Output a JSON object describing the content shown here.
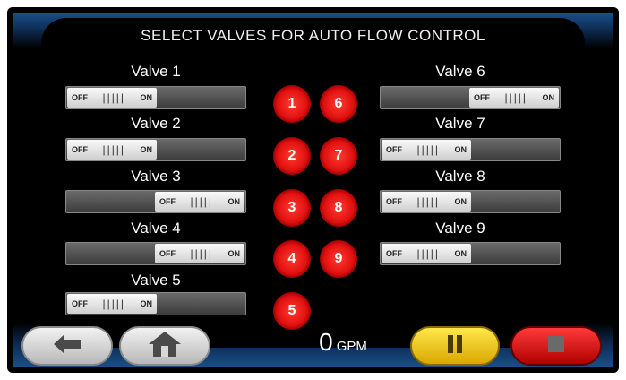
{
  "screen": {
    "title": "SELECT VALVES FOR AUTO FLOW CONTROL"
  },
  "toggle_text": {
    "off": "OFF",
    "on": "ON",
    "grip": "|||||"
  },
  "valves_left": [
    {
      "label": "Valve 1",
      "state": "off"
    },
    {
      "label": "Valve 2",
      "state": "off"
    },
    {
      "label": "Valve 3",
      "state": "on"
    },
    {
      "label": "Valve 4",
      "state": "on"
    },
    {
      "label": "Valve 5",
      "state": "off"
    }
  ],
  "valves_right": [
    {
      "label": "Valve 6",
      "state": "on"
    },
    {
      "label": "Valve 7",
      "state": "off"
    },
    {
      "label": "Valve 8",
      "state": "off"
    },
    {
      "label": "Valve 9",
      "state": "off"
    }
  ],
  "buttons": [
    "1",
    "6",
    "2",
    "7",
    "3",
    "8",
    "4",
    "9",
    "5"
  ],
  "flow": {
    "value": "0",
    "unit": "GPM"
  },
  "nav": {
    "back_icon": "left-arrow-icon",
    "home_icon": "home-icon",
    "pause_icon": "pause-icon",
    "stop_icon": "stop-icon"
  },
  "colors": {
    "accent_blue": "#1a4f8a",
    "valve_red": "#e01010",
    "pause_yellow": "#f2c200",
    "stop_red": "#d00000"
  }
}
